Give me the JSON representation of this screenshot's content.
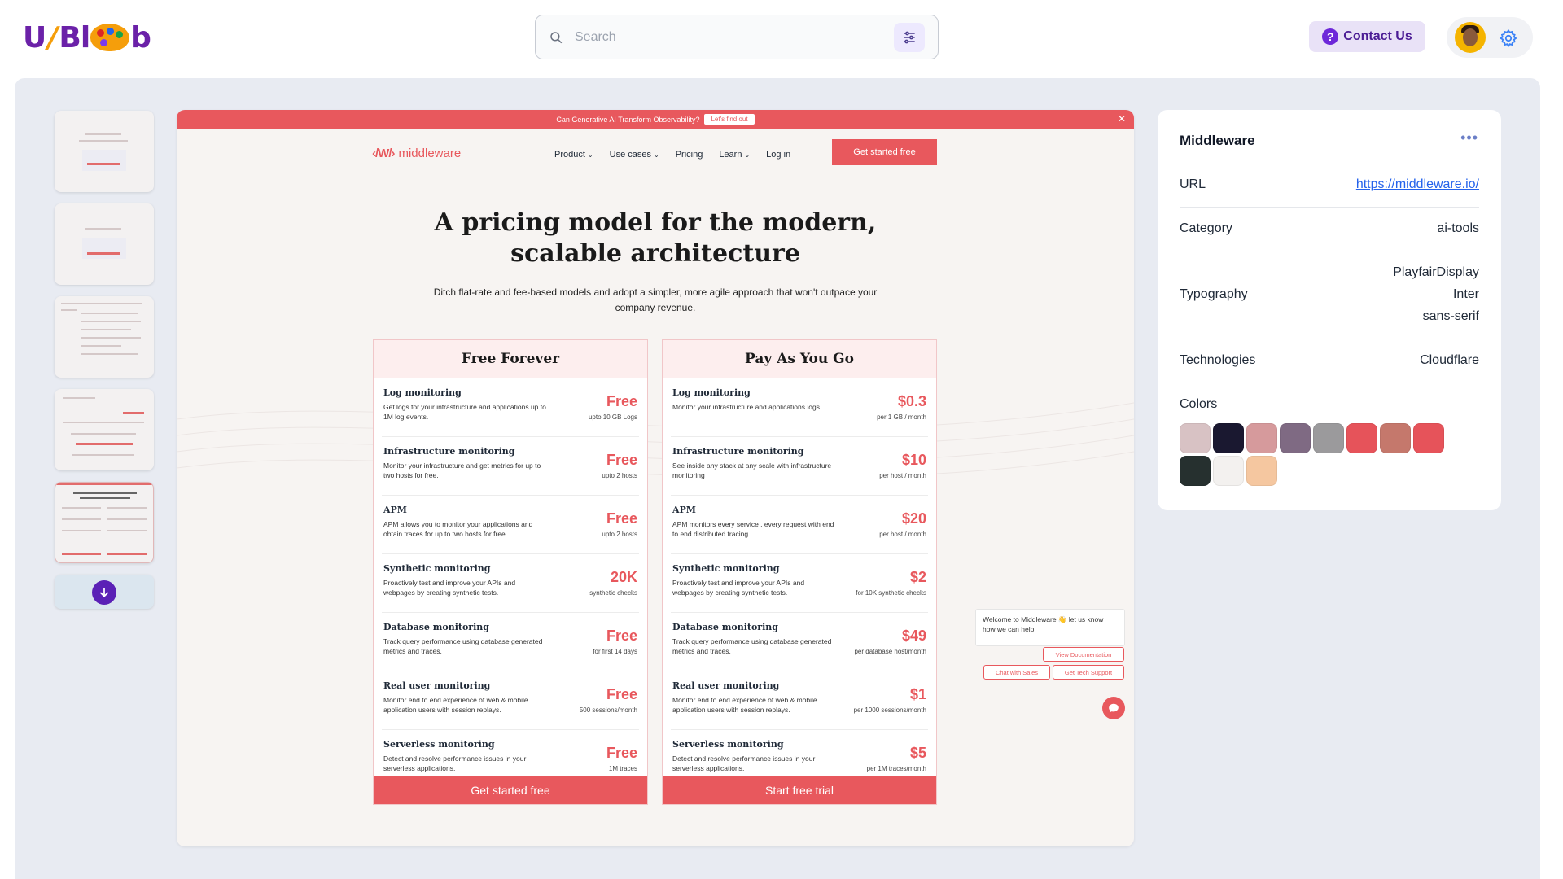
{
  "header": {
    "logo_text": "UIBlob",
    "search_placeholder": "Search",
    "contact_label": "Contact Us",
    "icons": [
      "search-icon",
      "filter-icon",
      "help-icon",
      "avatar",
      "gear-icon"
    ]
  },
  "preview": {
    "banner_text": "Can Generative AI Transform Observability?",
    "banner_button": "Let's find out",
    "nav": {
      "brand": "middleware",
      "links": [
        "Product",
        "Use cases",
        "Pricing",
        "Learn",
        "Log in"
      ],
      "cta": "Get started free"
    },
    "hero": {
      "title": "A pricing model for the modern, scalable architecture",
      "subtitle": "Ditch flat-rate and fee-based models and adopt a simpler, more agile approach that won't outpace your company revenue."
    },
    "plans": [
      {
        "name": "Free Forever",
        "button": "Get started free",
        "rows": [
          {
            "name": "Log monitoring",
            "desc": "Get logs for your infrastructure and applications up to 1M log events.",
            "price": "Free",
            "note": "upto 10 GB Logs"
          },
          {
            "name": "Infrastructure monitoring",
            "desc": "Monitor your infrastructure and get metrics for up to two hosts for free.",
            "price": "Free",
            "note": "upto 2 hosts"
          },
          {
            "name": "APM",
            "desc": "APM allows you to monitor your applications and obtain traces for up to two hosts for free.",
            "price": "Free",
            "note": "upto 2 hosts"
          },
          {
            "name": "Synthetic monitoring",
            "desc": "Proactively test and improve your APIs and webpages by creating synthetic tests.",
            "price": "20K",
            "note": "synthetic checks"
          },
          {
            "name": "Database monitoring",
            "desc": "Track query performance using database generated metrics and traces.",
            "price": "Free",
            "note": "for first 14 days"
          },
          {
            "name": "Real user monitoring",
            "desc": "Monitor end to end experience of web & mobile application users with session replays.",
            "price": "Free",
            "note": "500 sessions/month"
          },
          {
            "name": "Serverless monitoring",
            "desc": "Detect and resolve performance issues in your serverless applications.",
            "price": "Free",
            "note": "1M traces"
          }
        ]
      },
      {
        "name": "Pay As You Go",
        "button": "Start free trial",
        "rows": [
          {
            "name": "Log monitoring",
            "desc": "Monitor your infrastructure and applications logs.",
            "price": "$0.3",
            "note": "per 1 GB / month"
          },
          {
            "name": "Infrastructure monitoring",
            "desc": "See inside any stack at any scale with infrastructure monitoring",
            "price": "$10",
            "note": "per host / month"
          },
          {
            "name": "APM",
            "desc": "APM monitors every service , every request with end to end distributed tracing.",
            "price": "$20",
            "note": "per host / month"
          },
          {
            "name": "Synthetic monitoring",
            "desc": "Proactively test and improve your APIs and webpages by creating synthetic tests.",
            "price": "$2",
            "note": "for 10K synthetic checks"
          },
          {
            "name": "Database monitoring",
            "desc": "Track query performance using database generated metrics and traces.",
            "price": "$49",
            "note": "per database host/month"
          },
          {
            "name": "Real user monitoring",
            "desc": "Monitor end to end experience of web & mobile application users with session replays.",
            "price": "$1",
            "note": "per 1000 sessions/month"
          },
          {
            "name": "Serverless monitoring",
            "desc": "Detect and resolve performance issues in your serverless applications.",
            "price": "$5",
            "note": "per 1M traces/month"
          }
        ]
      }
    ],
    "chat": {
      "welcome": "Welcome to Middleware 👋 let us know how we can help",
      "docs": "View Documentation",
      "sales": "Chat with Sales",
      "support": "Get Tech Support"
    }
  },
  "info": {
    "title": "Middleware",
    "url_label": "URL",
    "url": "https://middleware.io/",
    "category_label": "Category",
    "category": "ai-tools",
    "typography_label": "Typography",
    "typography": [
      "PlayfairDisplay",
      "Inter",
      "sans-serif"
    ],
    "technologies_label": "Technologies",
    "technologies": "Cloudflare",
    "colors_label": "Colors",
    "colors": [
      "#d8c2c4",
      "#1a1830",
      "#d69a9c",
      "#7f6a83",
      "#9b9a9c",
      "#e6535a",
      "#c5786c",
      "#e6535a",
      "#26302f",
      "#f3f1ef",
      "#f5c7a0"
    ]
  }
}
